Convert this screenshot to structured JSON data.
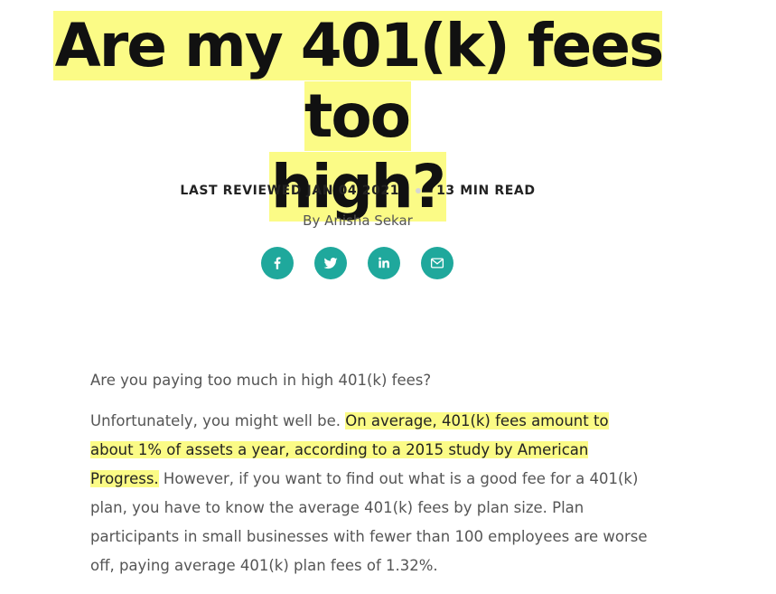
{
  "title": {
    "line1": "Are my 401(k) fees too",
    "line2": "high?"
  },
  "meta": {
    "reviewed": "LAST REVIEWED JAN 04 2021",
    "read_time": "13 MIN READ"
  },
  "byline": "By Anisha Sekar",
  "share": {
    "icons": [
      "facebook-icon",
      "twitter-icon",
      "linkedin-icon",
      "email-icon"
    ],
    "color": "#1fa89c"
  },
  "highlight_color": "#fbfb86",
  "article": {
    "p1": "Are you paying too much in high 401(k) fees?",
    "p2_intro": "Unfortunately, you might well be. ",
    "p2_highlight": "On average, 401(k) fees amount to about 1% of assets a year, according to a 2015 study by American Progress.",
    "p2_rest": " However, if you want to find out what is a good fee for a 401(k) plan, you have to know the average 401(k) fees by plan size. Plan participants in small businesses with fewer than 100 employees are worse off, paying average 401(k) plan fees of 1.32%."
  }
}
